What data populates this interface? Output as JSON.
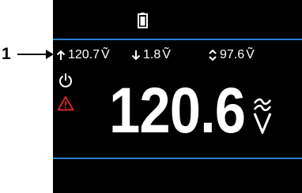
{
  "callout": {
    "number": "1"
  },
  "colors": {
    "screen_bg": "#000000",
    "divider": "#2e7fd2",
    "text": "#ffffff",
    "warning": "#d9242a"
  },
  "status_bar": {
    "icon": "battery-icon"
  },
  "stats": {
    "max": {
      "icon": "arrow-up-icon",
      "value": "120.7",
      "unit": "Ṽ"
    },
    "min": {
      "icon": "arrow-down-icon",
      "value": "1.8",
      "unit": "Ṽ"
    },
    "avg": {
      "icon": "up-down-chevron-icon",
      "value": "97.6",
      "unit": "Ṽ"
    }
  },
  "indicators": [
    "power-icon",
    "warning-icon"
  ],
  "main_reading": {
    "value": "120.6",
    "unit": "Ṽ"
  }
}
